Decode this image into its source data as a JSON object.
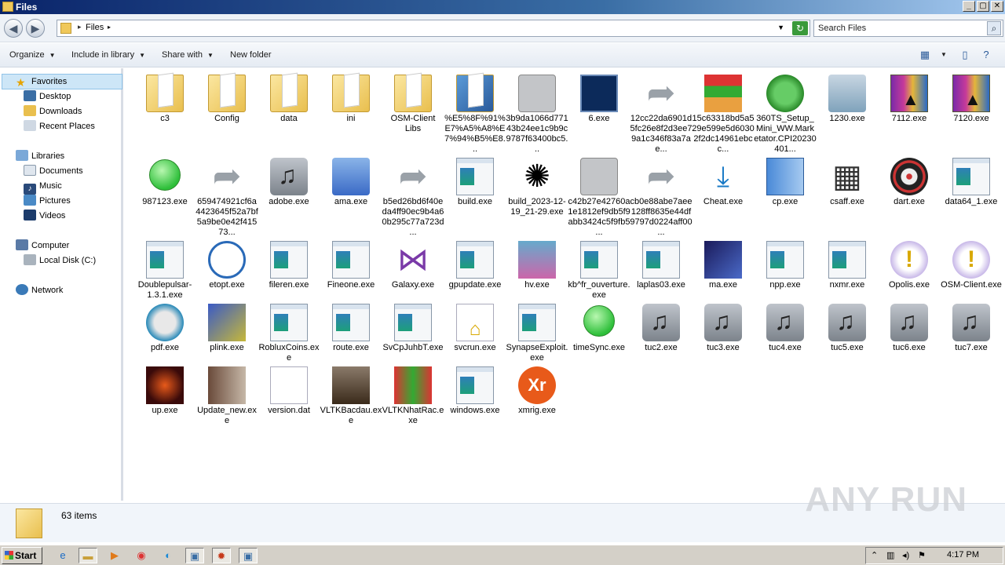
{
  "window": {
    "title": "Files",
    "min": "_",
    "max": "▢",
    "close": "✕"
  },
  "address": {
    "crumb": "Files",
    "search_placeholder": "Search Files"
  },
  "toolbar": {
    "organize": "Organize",
    "include": "Include in library",
    "share": "Share with",
    "new_folder": "New folder"
  },
  "nav": {
    "favorites": "Favorites",
    "desktop": "Desktop",
    "downloads": "Downloads",
    "recent": "Recent Places",
    "libraries": "Libraries",
    "documents": "Documents",
    "music": "Music",
    "pictures": "Pictures",
    "videos": "Videos",
    "computer": "Computer",
    "localdisk": "Local Disk (C:)",
    "network": "Network"
  },
  "items": [
    {
      "label": "c3",
      "icon": "folder"
    },
    {
      "label": "Config",
      "icon": "folder"
    },
    {
      "label": "data",
      "icon": "folder"
    },
    {
      "label": "ini",
      "icon": "folder"
    },
    {
      "label": "OSM-Client Libs",
      "icon": "folder"
    },
    {
      "label": "%E5%8F%91%E7%A5%A8%E7%94%B5%E8...",
      "icon": "shield-folder"
    },
    {
      "label": "3b9da1066d77143b24ee1c9b9c9787f63400bc5...",
      "icon": "gray"
    },
    {
      "label": "6.exe",
      "icon": "monitor"
    },
    {
      "label": "12cc22da6901d5fc26e8f2d3ee79a1c346f83a7ae...",
      "icon": "arrow"
    },
    {
      "label": "15c63318bd5a529e599e5d60302f2dc14961ebcc...",
      "icon": "box"
    },
    {
      "label": "360TS_Setup_Mini_WW.Marketator.CPI20230401...",
      "icon": "green-shield"
    },
    {
      "label": "1230.exe",
      "icon": "disc"
    },
    {
      "label": "7112.exe",
      "icon": "winrar"
    },
    {
      "label": "7120.exe",
      "icon": "winrar"
    },
    {
      "label": "987123.exe",
      "icon": "green"
    },
    {
      "label": "659474921cf6a4423645f52a7bf5a9be0e42f41573...",
      "icon": "arrow"
    },
    {
      "label": "adobe.exe",
      "icon": "music"
    },
    {
      "label": "ama.exe",
      "icon": "pc"
    },
    {
      "label": "b5ed26bd6f40eda4ff90ec9b4a60b295c77a723d...",
      "icon": "arrow"
    },
    {
      "label": "build.exe",
      "icon": "exe"
    },
    {
      "label": "build_2023-12-19_21-29.exe",
      "icon": "spinner"
    },
    {
      "label": "c42b27e42760a1e1812ef9db5f9abb3424c5f9fb5...",
      "icon": "gray"
    },
    {
      "label": "cb0e88abe7aee128ff8635e44df9797d0224aff00...",
      "icon": "arrow"
    },
    {
      "label": "Cheat.exe",
      "icon": "download"
    },
    {
      "label": "cp.exe",
      "icon": "bluebox"
    },
    {
      "label": "csaff.exe",
      "icon": "gift"
    },
    {
      "label": "dart.exe",
      "icon": "dart"
    },
    {
      "label": "data64_1.exe",
      "icon": "exe"
    },
    {
      "label": "Doublepulsar-1.3.1.exe",
      "icon": "exe"
    },
    {
      "label": "etopt.exe",
      "icon": "clock"
    },
    {
      "label": "fileren.exe",
      "icon": "exe"
    },
    {
      "label": "Fineone.exe",
      "icon": "exe"
    },
    {
      "label": "Galaxy.exe",
      "icon": "vs"
    },
    {
      "label": "gpupdate.exe",
      "icon": "exe"
    },
    {
      "label": "hv.exe",
      "icon": "hv"
    },
    {
      "label": "kb^fr_ouverture.exe",
      "icon": "exe"
    },
    {
      "label": "laplas03.exe",
      "icon": "exe"
    },
    {
      "label": "ma.exe",
      "icon": "ma"
    },
    {
      "label": "npp.exe",
      "icon": "exe"
    },
    {
      "label": "nxmr.exe",
      "icon": "exe"
    },
    {
      "label": "Opolis.exe",
      "icon": "warn"
    },
    {
      "label": "OSM-Client.exe",
      "icon": "warn"
    },
    {
      "label": "pdf.exe",
      "icon": "pdf"
    },
    {
      "label": "plink.exe",
      "icon": "plink"
    },
    {
      "label": "RobluxCoins.exe",
      "icon": "exe"
    },
    {
      "label": "route.exe",
      "icon": "exe"
    },
    {
      "label": "SvCpJuhbT.exe",
      "icon": "exe"
    },
    {
      "label": "svcrun.exe",
      "icon": "svcrun"
    },
    {
      "label": "SynapseExploit.exe",
      "icon": "exe"
    },
    {
      "label": "timeSync.exe",
      "icon": "green"
    },
    {
      "label": "tuc2.exe",
      "icon": "music"
    },
    {
      "label": "tuc3.exe",
      "icon": "music"
    },
    {
      "label": "tuc4.exe",
      "icon": "music"
    },
    {
      "label": "tuc5.exe",
      "icon": "music"
    },
    {
      "label": "tuc6.exe",
      "icon": "music"
    },
    {
      "label": "tuc7.exe",
      "icon": "music"
    },
    {
      "label": "up.exe",
      "icon": "up"
    },
    {
      "label": "Update_new.exe",
      "icon": "update"
    },
    {
      "label": "version.dat",
      "icon": "dat"
    },
    {
      "label": "VLTKBacdau.exe",
      "icon": "knight"
    },
    {
      "label": "VLTKNhatRac.exe",
      "icon": "itr"
    },
    {
      "label": "windows.exe",
      "icon": "exe"
    },
    {
      "label": "xmrig.exe",
      "icon": "xmrig"
    }
  ],
  "status": {
    "count": "63 items"
  },
  "watermark": "ANY RUN",
  "taskbar": {
    "start": "Start",
    "time": "4:17 PM"
  }
}
